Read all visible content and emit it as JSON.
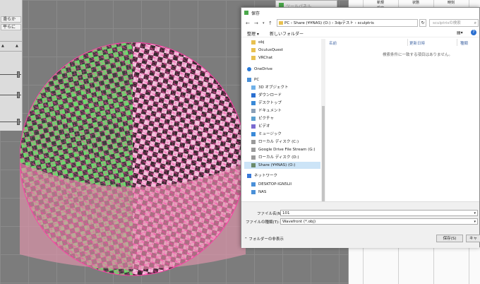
{
  "left_panel": {
    "btn1": "滑らか",
    "btn2": "平らに"
  },
  "tool_palette": {
    "title": "ツールパネル"
  },
  "right_panel": {
    "col1": "新規",
    "col2": "状態",
    "col3": "時刻",
    "cell1": "設定"
  },
  "dialog": {
    "title": "保存",
    "breadcrumb": "PC › Share (¥¥NAS) (O:) › 3dpテスト › sculptris",
    "search_placeholder": "sculptrisの検索",
    "organize": "整理 ▾",
    "new_folder": "新しいフォルダー",
    "nav": [
      {
        "label": "obj",
        "icon": "folder-icon"
      },
      {
        "label": "OculusQuest",
        "icon": "folder-icon"
      },
      {
        "label": "VRChat",
        "icon": "folder-icon"
      },
      {
        "label": "OneDrive",
        "icon": "cloud-icon"
      },
      {
        "label": "PC",
        "icon": "pc-icon"
      },
      {
        "label": "3D オブジェクト",
        "icon": "cube-icon"
      },
      {
        "label": "ダウンロード",
        "icon": "download-icon"
      },
      {
        "label": "デスクトップ",
        "icon": "desktop-icon"
      },
      {
        "label": "ドキュメント",
        "icon": "document-icon"
      },
      {
        "label": "ピクチャ",
        "icon": "picture-icon"
      },
      {
        "label": "ビデオ",
        "icon": "video-icon"
      },
      {
        "label": "ミュージック",
        "icon": "music-icon"
      },
      {
        "label": "ローカル ディスク (C:)",
        "icon": "disk-icon"
      },
      {
        "label": "Google Drive File Stream (G:)",
        "icon": "disk-icon"
      },
      {
        "label": "ローカル ディスク (D:)",
        "icon": "disk-icon"
      },
      {
        "label": "Share (¥¥NAS) (O:)",
        "icon": "network-drive-icon"
      },
      {
        "label": "ネットワーク",
        "icon": "network-icon"
      },
      {
        "label": "DESKTOP-IGN5LII",
        "icon": "computer-icon"
      },
      {
        "label": "NAS",
        "icon": "computer-icon"
      }
    ],
    "columns": {
      "name": "名前",
      "date": "更新日時",
      "type": "種類"
    },
    "empty_message": "検索条件に一致する項目はありません。",
    "filename_label": "ファイル名(N):",
    "filename_value": "101",
    "filetype_label": "ファイルの種類(T):",
    "filetype_value": "Wavefront (*.obj)",
    "hide_folders": "フォルダーの非表示",
    "save_button": "保存(S)",
    "cancel_button": "キャ"
  }
}
